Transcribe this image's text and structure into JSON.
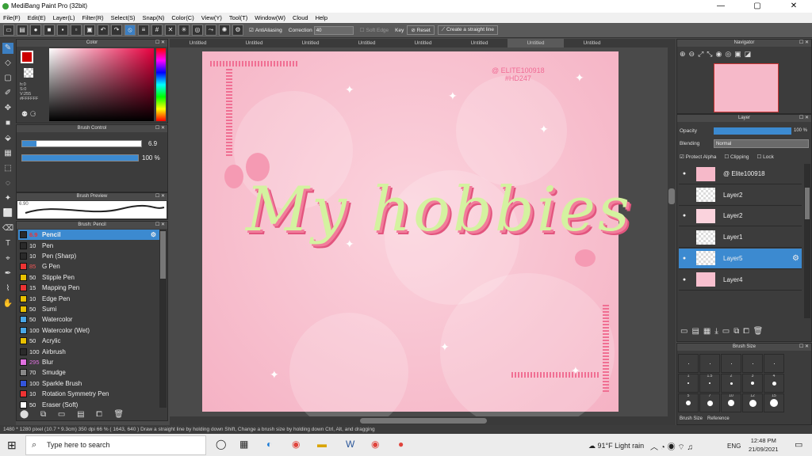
{
  "window": {
    "title": "MediBang Paint Pro (32bit)",
    "min": "—",
    "max": "▢",
    "close": "✕"
  },
  "menu": [
    "File(F)",
    "Edit(E)",
    "Layer(L)",
    "Filter(R)",
    "Select(S)",
    "Snap(N)",
    "Color(C)",
    "View(Y)",
    "Tool(T)",
    "Window(W)",
    "Cloud",
    "Help"
  ],
  "toolbar": {
    "antialias": "AntiAliasing",
    "correction": "Correction",
    "correction_val": "40",
    "soft_edge": "Soft Edge",
    "key": "Key",
    "reset": "Reset",
    "straight": "Create a straight line"
  },
  "color_panel": {
    "title": "Color",
    "h": "h:0",
    "s": "S:0",
    "v": "V:255",
    "hex": "#FFFFFF"
  },
  "brush_control": {
    "title": "Brush Control",
    "size": "6.9",
    "opacity": "100 %"
  },
  "brush_preview": {
    "title": "Brush Preview",
    "size": "6.90"
  },
  "brush_list": {
    "title": "Brush: Pencil",
    "items": [
      {
        "size": "6.9",
        "name": "Pencil",
        "color": "#2a2a2a"
      },
      {
        "size": "10",
        "name": "Pen",
        "color": "#2a2a2a"
      },
      {
        "size": "10",
        "name": "Pen (Sharp)",
        "color": "#2a2a2a"
      },
      {
        "size": "85",
        "name": "G Pen",
        "color": "#e33"
      },
      {
        "size": "50",
        "name": "Stipple Pen",
        "color": "#e8c000"
      },
      {
        "size": "15",
        "name": "Mapping Pen",
        "color": "#e33"
      },
      {
        "size": "10",
        "name": "Edge Pen",
        "color": "#e8c000"
      },
      {
        "size": "50",
        "name": "Sumi",
        "color": "#e8c000"
      },
      {
        "size": "50",
        "name": "Watercolor",
        "color": "#4aa8e8"
      },
      {
        "size": "100",
        "name": "Watercolor (Wet)",
        "color": "#4aa8e8"
      },
      {
        "size": "50",
        "name": "Acrylic",
        "color": "#e8c000"
      },
      {
        "size": "100",
        "name": "Airbrush",
        "color": "#2a2a2a"
      },
      {
        "size": "295",
        "name": "Blur",
        "color": "#e070e0"
      },
      {
        "size": "70",
        "name": "Smudge",
        "color": "#888"
      },
      {
        "size": "100",
        "name": "Sparkle Brush",
        "color": "#3355dd"
      },
      {
        "size": "10",
        "name": "Rotation Symmetry Pen",
        "color": "#e33"
      },
      {
        "size": "50",
        "name": "Eraser (Soft)",
        "color": "#fff"
      }
    ]
  },
  "tabs": [
    "Untitled",
    "Untitled",
    "Untitled",
    "Untitled",
    "Untitled",
    "Untitled",
    "Untitled",
    "Untitled"
  ],
  "artwork": {
    "title": "My hobbies",
    "watermark1": "@ ELITE100918",
    "watermark2": "#HD247"
  },
  "navigator": {
    "title": "Navigator"
  },
  "layer_panel": {
    "title": "Layer",
    "opacity_label": "Opacity",
    "opacity_val": "100 %",
    "blending_label": "Blending",
    "blending_val": "Normal",
    "protect": "Protect Alpha",
    "clipping": "Clipping",
    "lock": "Lock",
    "layers": [
      {
        "name": "@ Elite100918"
      },
      {
        "name": "Layer2"
      },
      {
        "name": "Layer2"
      },
      {
        "name": "Layer1"
      },
      {
        "name": "Layer5"
      },
      {
        "name": "Layer4"
      }
    ]
  },
  "brush_size": {
    "title": "Brush Size",
    "tab1": "Brush Size",
    "tab2": "Reference",
    "nums": [
      "1",
      "1.5",
      "2",
      "3",
      "4",
      "5",
      "7",
      "10",
      "12",
      "15"
    ]
  },
  "status": "1480 * 1280 pixel  (10.7 * 9.3cm)  350 dpi  66 %  ( 1643, 640 )  Draw a straight line by holding down Shift, Change a brush size by holding down Ctrl, Alt, and dragging",
  "taskbar": {
    "search": "Type here to search",
    "weather": "91°F  Light rain",
    "lang": "ENG",
    "time": "12:48 PM",
    "date": "21/09/2021"
  }
}
